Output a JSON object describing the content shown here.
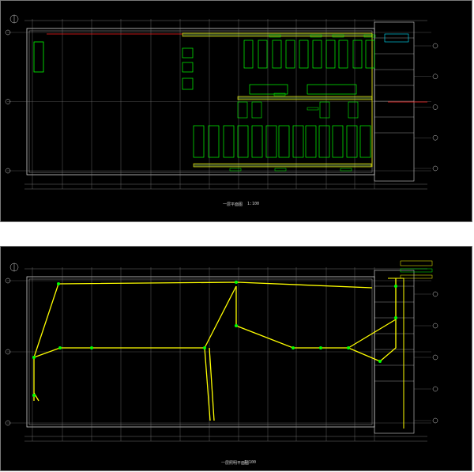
{
  "colors": {
    "background": "#000000",
    "frame": "#7a7a7a",
    "wall": "#cfcfcf",
    "grid": "#8a8a8a",
    "equipment": "#00ff00",
    "highlight": "#ffff00",
    "red": "#ff2020",
    "cyan": "#00e5ff"
  },
  "drawings": [
    {
      "title": "一层平面图",
      "scale": "1:100"
    },
    {
      "title": "一层照明平面图",
      "scale": "1:100"
    }
  ]
}
